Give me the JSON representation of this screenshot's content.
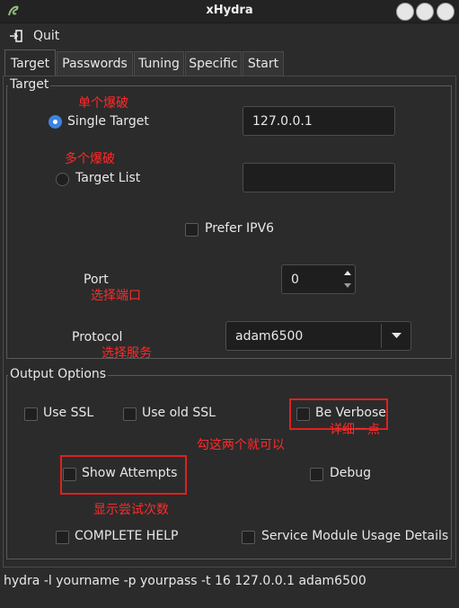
{
  "window": {
    "title": "xHydra"
  },
  "menu": {
    "quit_label": "Quit"
  },
  "tabs": [
    {
      "label": "Target"
    },
    {
      "label": "Passwords"
    },
    {
      "label": "Tuning"
    },
    {
      "label": "Specific"
    },
    {
      "label": "Start"
    }
  ],
  "target_group": {
    "title": "Target",
    "single_target_label": "Single Target",
    "single_target_value": "127.0.0.1",
    "target_list_label": "Target List",
    "target_list_value": "",
    "prefer_ipv6_label": "Prefer IPV6",
    "port_label": "Port",
    "port_value": "0",
    "protocol_label": "Protocol",
    "protocol_value": "adam6500"
  },
  "output_group": {
    "title": "Output Options",
    "use_ssl": "Use SSL",
    "use_old_ssl": "Use old SSL",
    "be_verbose": "Be Verbose",
    "show_attempts": "Show Attempts",
    "debug": "Debug",
    "complete_help": "COMPLETE HELP",
    "service_module": "Service Module Usage Details"
  },
  "annotations": {
    "single_attack": "单个爆破",
    "multi_attack": "多个爆破",
    "choose_port": "选择端口",
    "choose_service": "选择服务",
    "details": "详细一点",
    "check_these_two": "勾这两个就可以",
    "show_attempt_count": "显示尝试次数"
  },
  "command_line": "hydra -l yourname -p yourpass -t 16 127.0.0.1 adam6500",
  "colors": {
    "accent": "#3d84e0",
    "annotation": "#ff2a2a",
    "background": "#2b2b2b"
  }
}
